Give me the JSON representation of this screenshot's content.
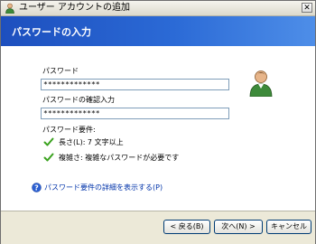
{
  "window": {
    "title": "ユーザー アカウントの追加",
    "close_glyph": "✕"
  },
  "header": {
    "title": "パスワードの入力"
  },
  "form": {
    "password_label": "パスワード",
    "password_value": "*************",
    "confirm_label": "パスワードの確認入力",
    "confirm_value": "*************",
    "requirements_title": "パスワード要件:",
    "requirements": [
      "長さ(L): 7 文字以上",
      "複雑さ: 複雑なパスワードが必要です"
    ],
    "details_link": "パスワード要件の詳細を表示する(P)"
  },
  "footer": {
    "back_label": "< 戻る(B)",
    "next_label": "次へ(N) >",
    "cancel_label": "キャンセル"
  },
  "colors": {
    "header_blue": "#2b6ad6",
    "check_green": "#3aa21e",
    "link_blue": "#0033aa",
    "help_blue": "#2b5fd1"
  },
  "icons": {
    "title": "user-accounts-icon",
    "avatar": "user-avatar-icon",
    "check": "check-icon",
    "help": "help-icon"
  }
}
